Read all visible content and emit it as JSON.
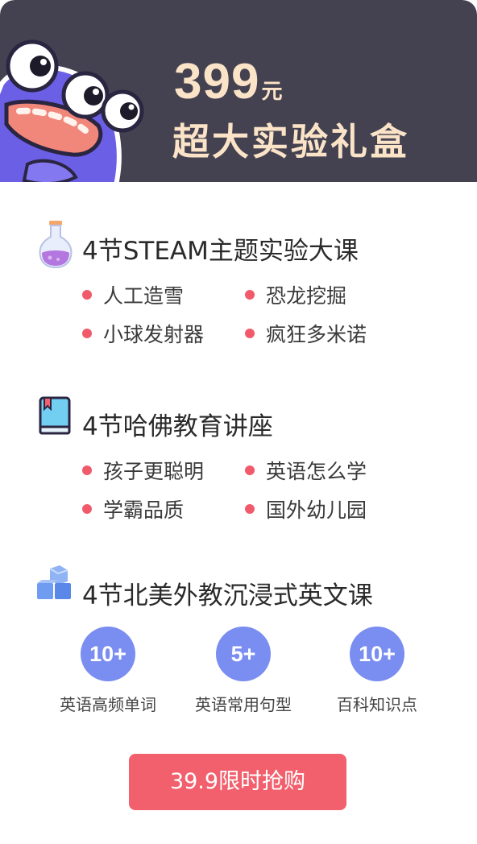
{
  "header": {
    "price": "399",
    "price_unit": "元",
    "title": "超大实验礼盒",
    "mascot_icon": "monster-mascot-icon",
    "colors": {
      "background": "#444250",
      "text": "#fbe3c8"
    }
  },
  "sections": [
    {
      "icon": "flask-icon",
      "title": "4节STEAM主题实验大课",
      "items": [
        "人工造雪",
        "恐龙挖掘",
        "小球发射器",
        "疯狂多米诺"
      ]
    },
    {
      "icon": "book-icon",
      "title": "4节哈佛教育讲座",
      "items": [
        "孩子更聪明",
        "英语怎么学",
        "学霸品质",
        "国外幼儿园"
      ]
    },
    {
      "icon": "blocks-icon",
      "title": "4节北美外教沉浸式英文课"
    }
  ],
  "stats": [
    {
      "value": "10+",
      "label": "英语高频单词"
    },
    {
      "value": "5+",
      "label": "英语常用句型"
    },
    {
      "value": "10+",
      "label": "百科知识点"
    }
  ],
  "cta": {
    "label": "39.9限时抢购",
    "color": "#f2606d"
  },
  "accent_colors": {
    "bullet": "#f15a6b",
    "stat_circle": "#7a8df0"
  }
}
